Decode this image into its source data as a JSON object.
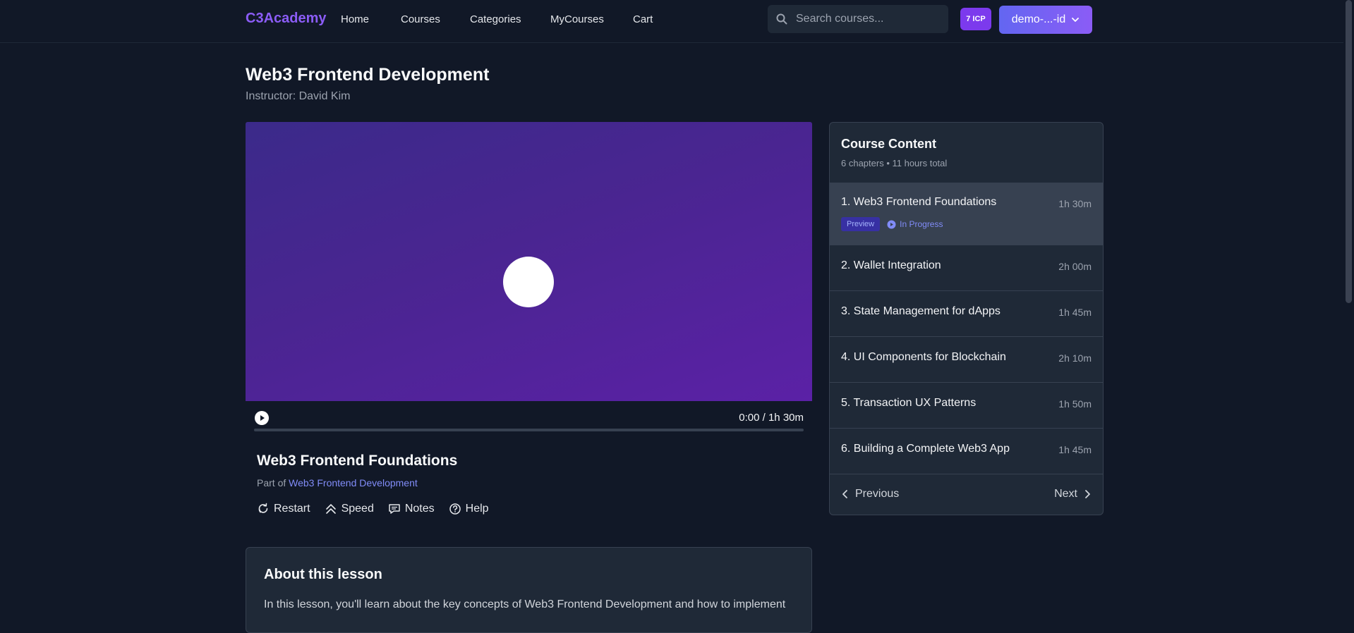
{
  "nav": {
    "logo": "C3Academy",
    "links": [
      "Home",
      "Courses",
      "Categories",
      "MyCourses",
      "Cart"
    ],
    "search_placeholder": "Search courses...",
    "icp_badge": "7 ICP",
    "user_label": "demo-...-id"
  },
  "course": {
    "title": "Web3 Frontend Development",
    "instructor": "Instructor: David Kim"
  },
  "player": {
    "time": "0:00 / 1h 30m",
    "progress_fraction": 0
  },
  "lesson": {
    "title": "Web3 Frontend Foundations",
    "part_of_prefix": "Part of",
    "part_of_link": "Web3 Frontend Development",
    "actions": [
      "Restart",
      "Speed",
      "Notes",
      "Help"
    ]
  },
  "about": {
    "heading": "About this lesson",
    "text": "In this lesson, you'll learn about the key concepts of Web3 Frontend Development and how to implement"
  },
  "sidebar": {
    "title": "Course Content",
    "subtitle": "6 chapters • 11 hours total",
    "chapters": [
      {
        "title": "1. Web3 Frontend Foundations",
        "duration": "1h 30m",
        "badge": "Preview",
        "status": "In Progress"
      },
      {
        "title": "2. Wallet Integration",
        "duration": "2h 00m"
      },
      {
        "title": "3. State Management for dApps",
        "duration": "1h 45m"
      },
      {
        "title": "4. UI Components for Blockchain",
        "duration": "2h 10m"
      },
      {
        "title": "5. Transaction UX Patterns",
        "duration": "1h 50m"
      },
      {
        "title": "6. Building a Complete Web3 App",
        "duration": "1h 45m"
      }
    ],
    "prev_label": "Previous",
    "next_label": "Next"
  },
  "colors": {
    "background": "#111827",
    "accent": "#8b5cf6",
    "panel": "#1f2937",
    "link": "#818cf8"
  }
}
